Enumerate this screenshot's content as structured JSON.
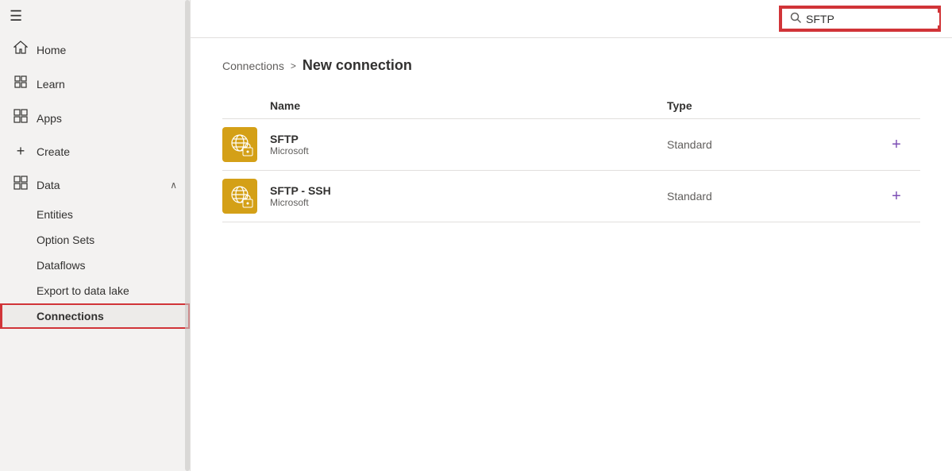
{
  "sidebar": {
    "hamburger": "☰",
    "nav_items": [
      {
        "id": "home",
        "icon": "⌂",
        "label": "Home",
        "active": false
      },
      {
        "id": "learn",
        "icon": "□",
        "label": "Learn",
        "active": false
      },
      {
        "id": "apps",
        "icon": "⊞",
        "label": "Apps",
        "active": false
      },
      {
        "id": "create",
        "icon": "+",
        "label": "Create",
        "active": false
      },
      {
        "id": "data",
        "icon": "⊞",
        "label": "Data",
        "active": true,
        "hasChevron": true,
        "chevron": "∧"
      }
    ],
    "sub_items": [
      {
        "id": "entities",
        "label": "Entities",
        "active": false
      },
      {
        "id": "option-sets",
        "label": "Option Sets",
        "active": false
      },
      {
        "id": "dataflows",
        "label": "Dataflows",
        "active": false
      },
      {
        "id": "export-to-data-lake",
        "label": "Export to data lake",
        "active": false
      },
      {
        "id": "connections",
        "label": "Connections",
        "active": true
      }
    ]
  },
  "topbar": {
    "search_value": "SFTP",
    "search_placeholder": "Search",
    "clear_label": "×"
  },
  "breadcrumb": {
    "parent": "Connections",
    "separator": ">",
    "current": "New connection"
  },
  "table": {
    "columns": {
      "name": "Name",
      "type": "Type"
    },
    "rows": [
      {
        "id": "sftp",
        "name": "SFTP",
        "publisher": "Microsoft",
        "type": "Standard",
        "add_label": "+"
      },
      {
        "id": "sftp-ssh",
        "name": "SFTP - SSH",
        "publisher": "Microsoft",
        "type": "Standard",
        "add_label": "+"
      }
    ]
  },
  "colors": {
    "accent_red": "#d13438",
    "accent_purple": "#7c4eb4",
    "connector_yellow": "#d4a017",
    "text_primary": "#323130",
    "text_secondary": "#605e5c"
  }
}
